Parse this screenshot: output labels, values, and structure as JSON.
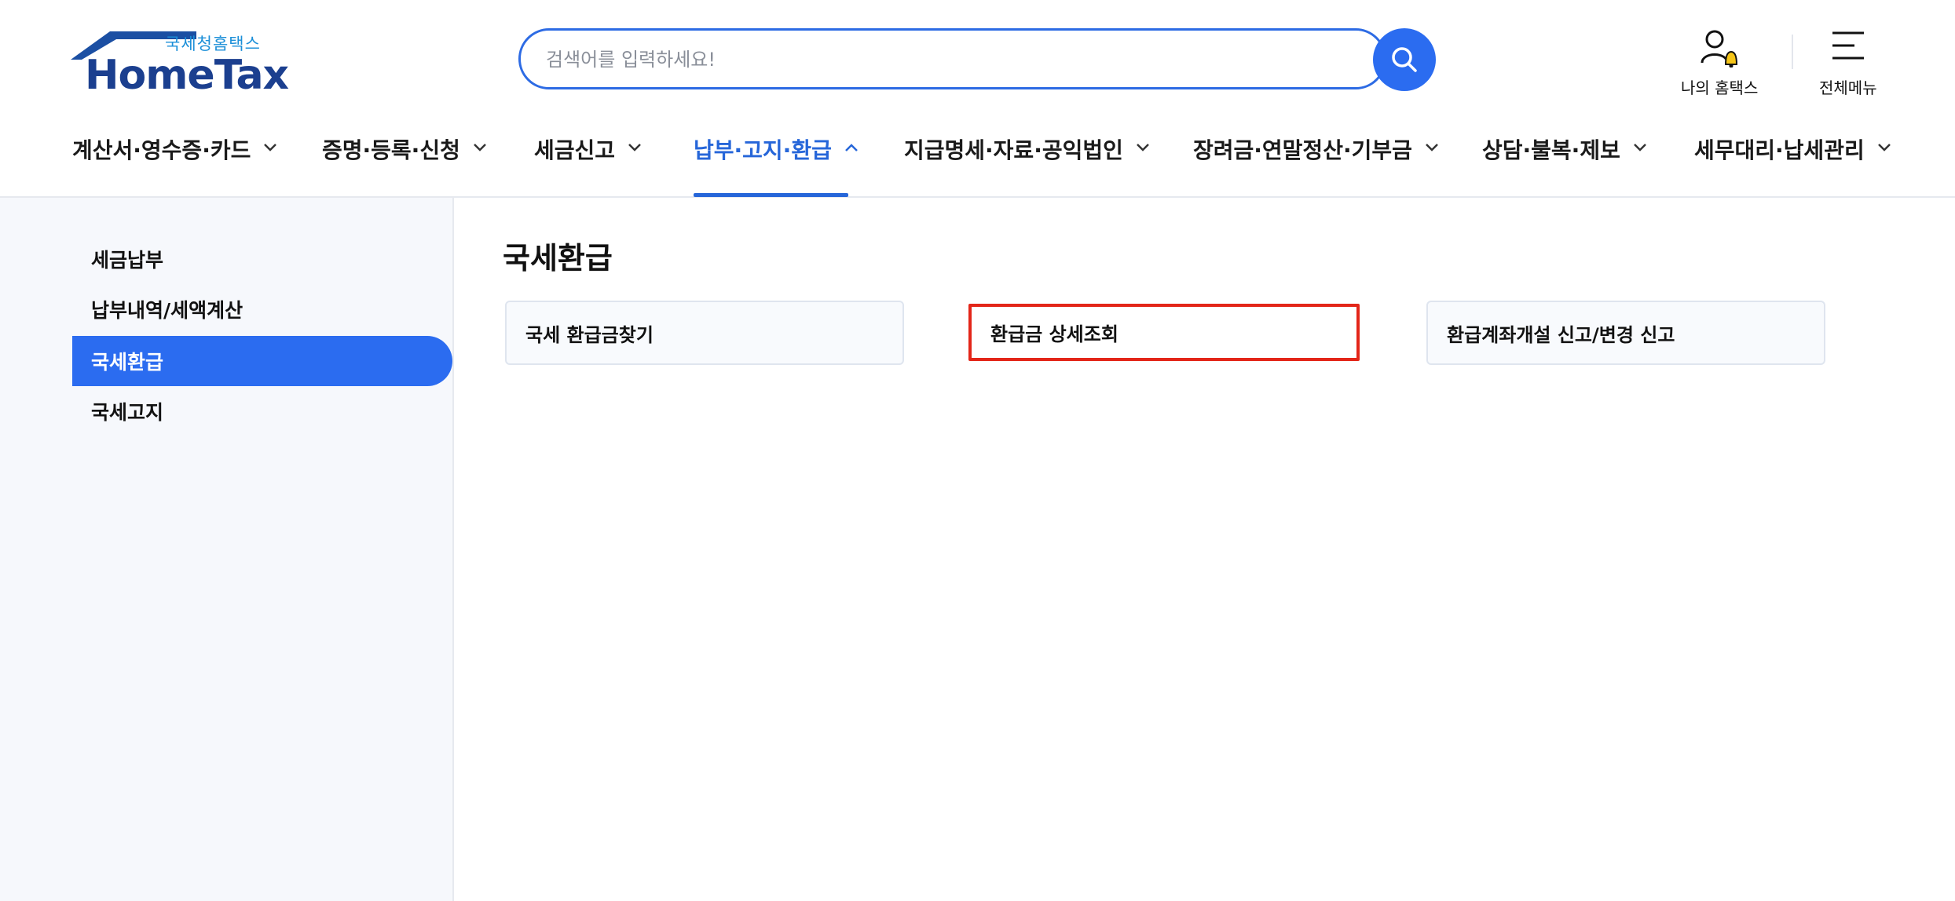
{
  "header": {
    "logo_sub": "국세청홈택스",
    "logo_main": "HomeTax",
    "search_placeholder": "검색어를 입력하세요!",
    "search_button_icon": "search-icon",
    "my_hometax_label": "나의 홈택스",
    "all_menu_label": "전체메뉴"
  },
  "gnb": [
    {
      "label": "계산서·영수증·카드",
      "expanded": false
    },
    {
      "label": "증명·등록·신청",
      "expanded": false
    },
    {
      "label": "세금신고",
      "expanded": false
    },
    {
      "label": "납부·고지·환급",
      "expanded": true
    },
    {
      "label": "지급명세·자료·공익법인",
      "expanded": false
    },
    {
      "label": "장려금·연말정산·기부금",
      "expanded": false
    },
    {
      "label": "상담·불복·제보",
      "expanded": false
    },
    {
      "label": "세무대리·납세관리",
      "expanded": false
    }
  ],
  "sidebar": {
    "items": [
      {
        "label": "세금납부"
      },
      {
        "label": "납부내역/세액계산"
      },
      {
        "label": "국세환급",
        "active": true
      },
      {
        "label": "국세고지"
      }
    ]
  },
  "main": {
    "title": "국세환급",
    "cards": [
      {
        "label": "국세 환급금찾기"
      },
      {
        "label": "환급금 상세조회",
        "highlighted": true
      },
      {
        "label": "환급계좌개설 신고/변경 신고"
      }
    ]
  },
  "colors": {
    "primary": "#2b6cf0",
    "active_text": "#2666d9",
    "highlight_border": "#e32619",
    "logo_blue": "#1b3f8f",
    "bell": "#f5c518"
  }
}
